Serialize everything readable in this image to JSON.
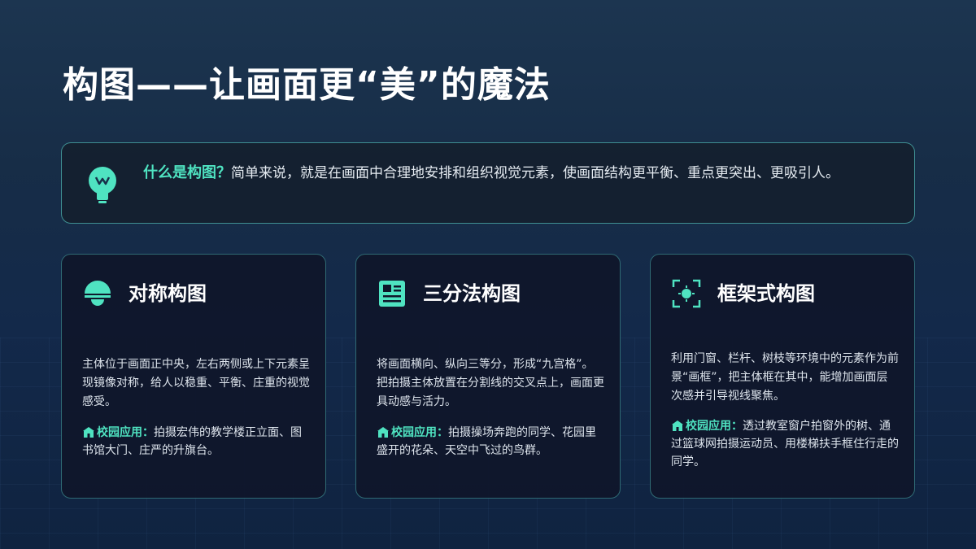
{
  "title": "构图——让画面更“美”的魔法",
  "intro": {
    "highlight": "什么是构图？",
    "text": "简单来说，就是在画面中合理地安排和组织视觉元素，使画面结构更平衡、重点更突出、更吸引人。"
  },
  "cards": [
    {
      "icon": "half-dome-icon",
      "title": "对称构图",
      "body": "主体位于画面正中央，左右两侧或上下元素呈现镜像对称，给人以稳重、平衡、庄重的视觉感受。",
      "app_label": "校园应用：",
      "app_text": "拍摄宏伟的教学楼正立面、图书馆大门、庄严的升旗台。"
    },
    {
      "icon": "grid-document-icon",
      "title": "三分法构图",
      "body": "将画面横向、纵向三等分，形成“九宫格”。把拍摄主体放置在分割线的交叉点上，画面更具动感与活力。",
      "app_label": "校园应用：",
      "app_text": "拍摄操场奔跑的同学、花园里盛开的花朵、天空中飞过的鸟群。"
    },
    {
      "icon": "focus-frame-icon",
      "title": "框架式构图",
      "body": "利用门窗、栏杆、树枝等环境中的元素作为前景“画框”，把主体框在其中，能增加画面层次感并引导视线聚焦。",
      "app_label": "校园应用：",
      "app_text": "透过教室窗户拍窗外的树、通过篮球网拍摄运动员、用楼梯扶手框住行走的同学。"
    }
  ],
  "colors": {
    "accent": "#4fe3c1",
    "border": "#3f8f92"
  }
}
